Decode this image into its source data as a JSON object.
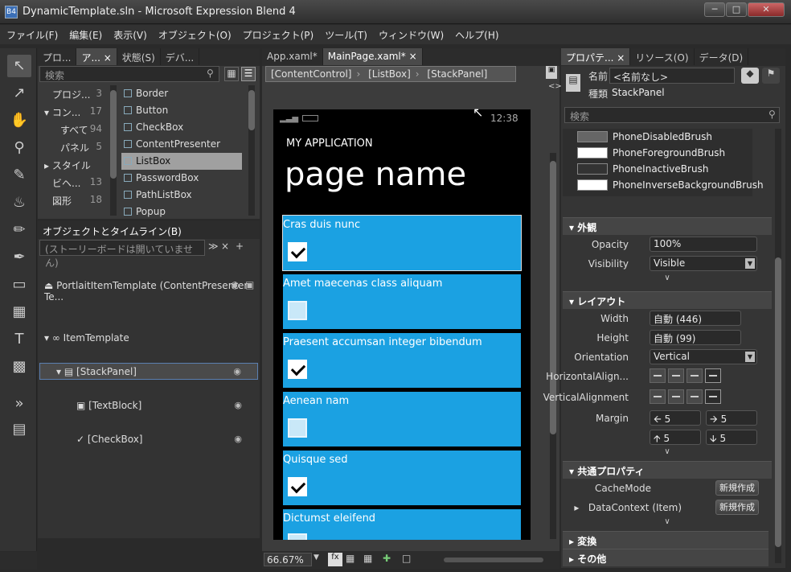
{
  "window": {
    "title": "DynamicTemplate.sln - Microsoft Expression Blend 4",
    "icon": "B4"
  },
  "menu": [
    "ファイル(F)",
    "編集(E)",
    "表示(V)",
    "オブジェクト(O)",
    "プロジェクト(P)",
    "ツール(T)",
    "ウィンドウ(W)",
    "ヘルプ(H)"
  ],
  "left_tabs": [
    "プロ...",
    "ア...",
    "状態(S)",
    "デバ..."
  ],
  "search_placeholder": "検索",
  "categories": [
    {
      "label": "プロジ...",
      "count": "3"
    },
    {
      "label": "コン...",
      "count": "17"
    },
    {
      "label": "すべて",
      "count": "94"
    },
    {
      "label": "パネル",
      "count": "5"
    },
    {
      "label": "スタイル",
      "count": ""
    },
    {
      "label": "ビヘ...",
      "count": "13"
    },
    {
      "label": "図形",
      "count": "18"
    }
  ],
  "assets": [
    "Border",
    "Button",
    "CheckBox",
    "ContentPresenter",
    "ListBox",
    "PasswordBox",
    "PathListBox",
    "Popup"
  ],
  "objects": {
    "header": "オブジェクトとタイムライン(B)",
    "storyboard": "(ストーリーボードは開いていません)",
    "root": "PortlaitItemTemplate (ContentPresenter Te...",
    "item_template": "ItemTemplate",
    "stackpanel": "[StackPanel]",
    "textblock": "[TextBlock]",
    "checkbox": "[CheckBox]"
  },
  "doc_tabs": [
    "App.xaml*",
    "MainPage.xaml*"
  ],
  "breadcrumb": [
    "[ContentControl]",
    "[ListBox]",
    "[StackPanel]"
  ],
  "phone": {
    "time": "12:38",
    "app": "MY APPLICATION",
    "page": "page name"
  },
  "list": [
    {
      "text": "Cras duis nunc",
      "checked": true
    },
    {
      "text": "Amet maecenas class aliquam",
      "checked": false
    },
    {
      "text": "Praesent accumsan integer bibendum",
      "checked": true
    },
    {
      "text": "Aenean nam",
      "checked": false
    },
    {
      "text": "Quisque sed",
      "checked": true
    },
    {
      "text": "Dictumst eleifend",
      "checked": false
    }
  ],
  "zoom": "66.67%",
  "right_tabs": [
    "プロパテ...",
    "リソース(O)",
    "データ(D)"
  ],
  "props": {
    "name_label": "名前",
    "name_value": "<名前なし>",
    "type_label": "種類",
    "type_value": "StackPanel",
    "search": "検索",
    "brushes": [
      {
        "name": "PhoneDisabledBrush",
        "color": "#666666"
      },
      {
        "name": "PhoneForegroundBrush",
        "color": "#ffffff"
      },
      {
        "name": "PhoneInactiveBrush",
        "color": "#333333"
      },
      {
        "name": "PhoneInverseBackgroundBrush",
        "color": "#ffffff"
      }
    ],
    "sec_appearance": "外観",
    "opacity_label": "Opacity",
    "opacity": "100%",
    "visibility_label": "Visibility",
    "visibility": "Visible",
    "sec_layout": "レイアウト",
    "width_label": "Width",
    "width": "自動 (446)",
    "height_label": "Height",
    "height": "自動 (99)",
    "orientation_label": "Orientation",
    "orientation": "Vertical",
    "halign_label": "HorizontalAlign...",
    "valign_label": "VerticalAlignment",
    "margin_label": "Margin",
    "margin": [
      "5",
      "5",
      "5",
      "5"
    ],
    "sec_common": "共通プロパティ",
    "cache_label": "CacheMode",
    "cache_btn": "新規作成",
    "datacontext_label": "DataContext (Item)",
    "datacontext_btn": "新規作成",
    "sec_transform": "変換",
    "sec_misc": "その他"
  }
}
